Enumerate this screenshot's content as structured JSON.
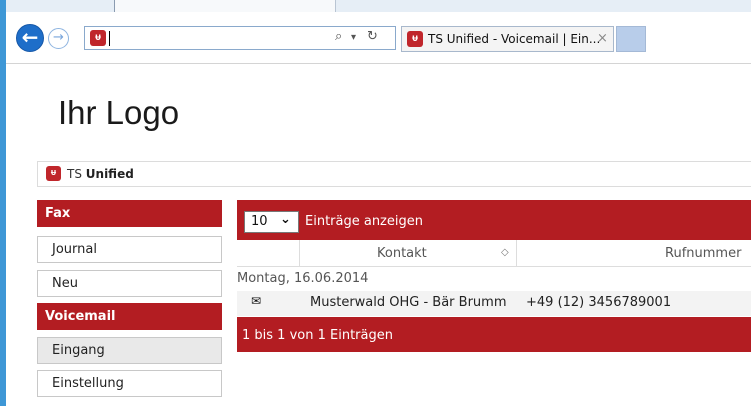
{
  "browser": {
    "back_glyph": "←",
    "forward_glyph": "→",
    "favicon_glyph": "ᵾ",
    "address_value": "",
    "search_glyph": "⌕",
    "dropdown_glyph": "▾",
    "refresh_glyph": "↻",
    "tab_title": "TS Unified - Voicemail | Ein...",
    "tab_close_glyph": "×"
  },
  "page": {
    "logo_text": "Ihr Logo",
    "brand_prefix": "TS",
    "brand_bold": "Unified"
  },
  "sidebar": {
    "fax_header": "Fax",
    "journal": "Journal",
    "neu": "Neu",
    "voicemail_header": "Voicemail",
    "eingang": "Eingang",
    "einstellung": "Einstellung"
  },
  "table": {
    "page_size": "10",
    "page_size_chevron": "⌄",
    "entries_label": "Einträge anzeigen",
    "columns": [
      "Kontakt",
      "Rufnummer"
    ],
    "sort_glyph": "◇",
    "group_label": "Montag, 16.06.2014",
    "rows": [
      {
        "icon": "envelope-icon",
        "icon_glyph": "✉",
        "contact": "Musterwald OHG - Bär Brumm",
        "number": "+49 (12) 3456789001"
      }
    ],
    "footer_info": "1 bis 1 von 1 Einträgen"
  },
  "colors": {
    "accent_red": "#b31d22",
    "browser_blue": "#1e6ec9"
  }
}
